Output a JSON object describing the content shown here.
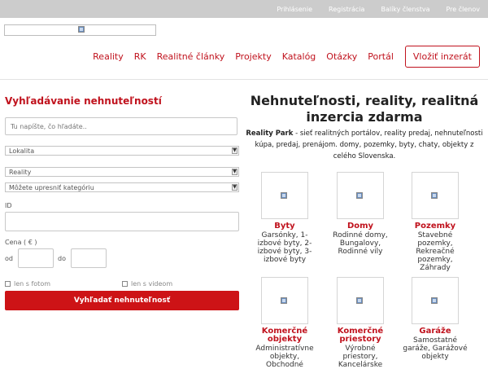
{
  "topbar": {
    "links": [
      "Prihlásenie",
      "Registrácia",
      "Balíky členstva",
      "Pre členov"
    ]
  },
  "nav": {
    "items": [
      "Reality",
      "RK",
      "Realitné články",
      "Projekty",
      "Katalóg",
      "Otázky",
      "Portál"
    ],
    "cta": "Vložiť inzerát"
  },
  "search": {
    "title": "Vyhľadávanie nehnuteľností",
    "query_placeholder": "Tu napíšte, čo hľadáte..",
    "location": "Lokalita",
    "type": "Reality",
    "category": "Môžete upresniť kategóriu",
    "id_label": "ID",
    "price_label": "Cena ( € )",
    "from_label": "od",
    "to_label": "do",
    "photo_label": "len s fotom",
    "video_label": "len s videom",
    "button": "Vyhľadať nehnuteľnosť"
  },
  "hero": {
    "title": "Nehnuteľnosti, reality, realitná inzercia zdarma",
    "brand": "Reality Park",
    "description": " - sieť realitných portálov, reality predaj, nehnuteľnosti kúpa, predaj, prenájom. domy, pozemky, byty, chaty, objekty z celého Slovenska."
  },
  "categories": [
    {
      "name": "Byty",
      "desc": "Garsónky, 1-izbové byty, 2-izbové byty, 3-izbové byty"
    },
    {
      "name": "Domy",
      "desc": "Rodinné domy, Bungalovy, Rodinné vily"
    },
    {
      "name": "Pozemky",
      "desc": "Stavebné pozemky, Rekreačné pozemky, Záhrady"
    },
    {
      "name": "Komerčné objekty",
      "desc": "Administratívne objekty, Obchodné"
    },
    {
      "name": "Komerčné priestory",
      "desc": "Výrobné priestory, Kancelárske"
    },
    {
      "name": "Garáže",
      "desc": "Samostatné garáže, Garážové objekty"
    }
  ],
  "colors": {
    "accent": "#c0121d",
    "button": "#cd1316",
    "topbar": "#cccccc"
  }
}
